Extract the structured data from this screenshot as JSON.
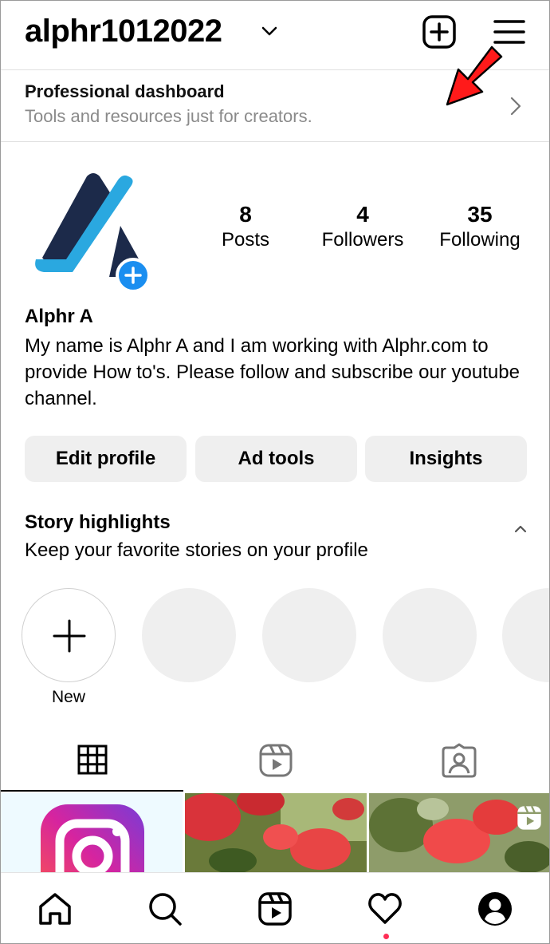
{
  "header": {
    "username": "alphr1012022"
  },
  "dashboard": {
    "title": "Professional dashboard",
    "subtitle": "Tools and resources just for creators."
  },
  "profile": {
    "stats": [
      {
        "value": "8",
        "label": "Posts"
      },
      {
        "value": "4",
        "label": "Followers"
      },
      {
        "value": "35",
        "label": "Following"
      }
    ],
    "name": "Alphr A",
    "bio": "My name is Alphr A and I am working with Alphr.com to provide How to's. Please follow and subscribe our youtube channel."
  },
  "buttons": {
    "edit_profile": "Edit profile",
    "ad_tools": "Ad tools",
    "insights": "Insights"
  },
  "highlights": {
    "title": "Story highlights",
    "subtitle": "Keep your favorite stories on your profile",
    "new_label": "New"
  },
  "colors": {
    "accent_blue": "#1a8ef0",
    "arrow_red": "#ff1a1a",
    "notification": "#ff2d55"
  },
  "icons": {
    "header": [
      "chevron-down-icon",
      "new-post-icon",
      "menu-icon"
    ],
    "tabs": [
      "grid-icon",
      "reels-icon",
      "tagged-icon"
    ],
    "nav": [
      "home-icon",
      "search-icon",
      "reels-icon",
      "heart-icon",
      "profile-icon"
    ]
  }
}
